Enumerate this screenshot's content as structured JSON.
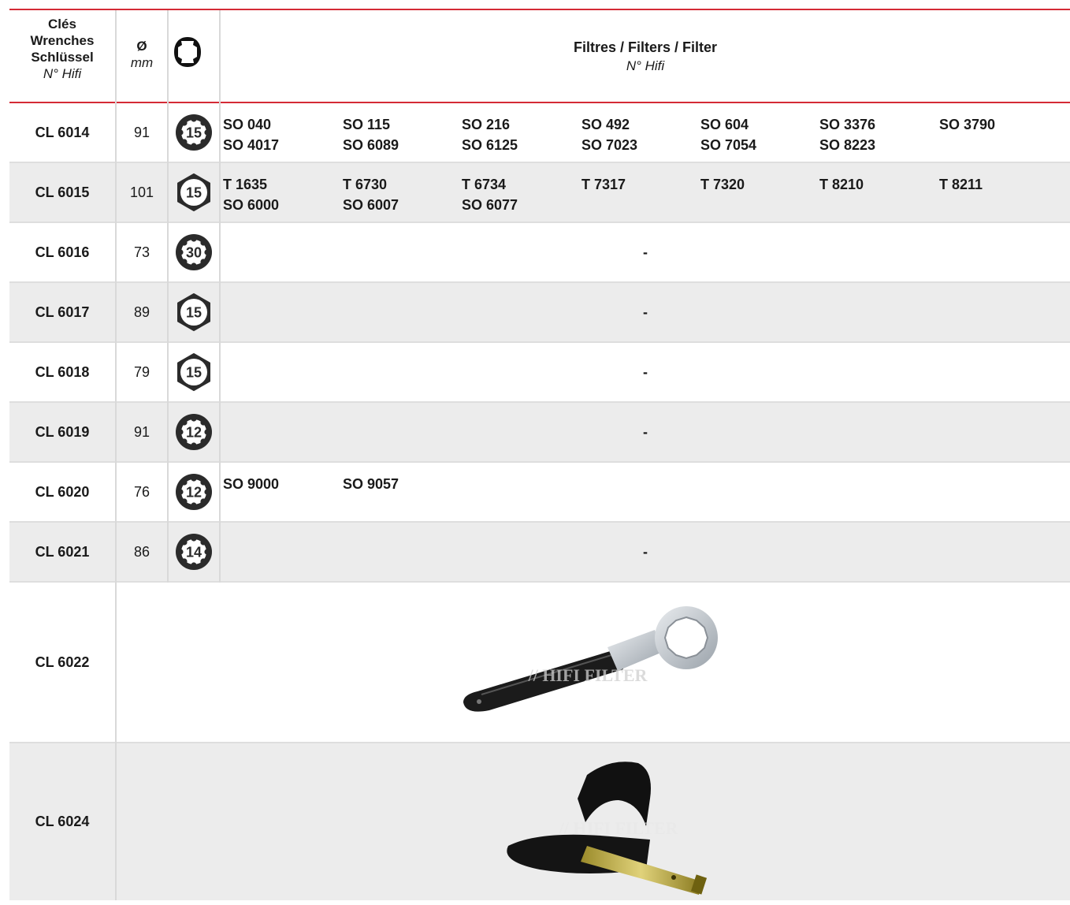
{
  "header": {
    "key_lines": [
      "Clés",
      "Wrenches",
      "Schlüssel"
    ],
    "key_sub": "N° Hifi",
    "dia_title": "Ø",
    "dia_unit": "mm",
    "filters_title": "Filtres / Filters / Filter",
    "filters_sub": "N° Hifi",
    "header_icon": "wrench-profile-icon"
  },
  "colors": {
    "accent": "#d42a35",
    "row_alt": "#ececec",
    "badge": "#2b2b2b"
  },
  "rows": [
    {
      "key": "CL 6014",
      "dia": "91",
      "icon": "splined-badge-icon",
      "badge": "15",
      "filters": [
        [
          "SO 040",
          "SO 4017"
        ],
        [
          "SO 115",
          "SO 6089"
        ],
        [
          "SO 216",
          "SO 6125"
        ],
        [
          "SO 492",
          "SO 7023"
        ],
        [
          "SO 604",
          "SO 7054"
        ],
        [
          "SO 3376",
          "SO 8223"
        ],
        [
          "SO 3790",
          ""
        ]
      ]
    },
    {
      "key": "CL 6015",
      "dia": "101",
      "icon": "hex-badge-icon",
      "badge": "15",
      "filters": [
        [
          "T 1635",
          "SO 6000"
        ],
        [
          "T 6730",
          "SO 6007"
        ],
        [
          "T 6734",
          "SO 6077"
        ],
        [
          "T 7317",
          ""
        ],
        [
          "T 7320",
          ""
        ],
        [
          "T 8210",
          ""
        ],
        [
          "T 8211",
          ""
        ]
      ]
    },
    {
      "key": "CL 6016",
      "dia": "73",
      "icon": "splined-badge-icon",
      "badge": "30",
      "dash": "-"
    },
    {
      "key": "CL 6017",
      "dia": "89",
      "icon": "hex-badge-icon",
      "badge": "15",
      "dash": "-"
    },
    {
      "key": "CL 6018",
      "dia": "79",
      "icon": "hex-badge-icon",
      "badge": "15",
      "dash": "-"
    },
    {
      "key": "CL 6019",
      "dia": "91",
      "icon": "splined-badge-icon",
      "badge": "12",
      "dash": "-"
    },
    {
      "key": "CL 6020",
      "dia": "76",
      "icon": "splined-badge-icon",
      "badge": "12",
      "filters": [
        [
          "SO 9000",
          ""
        ],
        [
          "SO 9057",
          ""
        ]
      ]
    },
    {
      "key": "CL 6021",
      "dia": "86",
      "icon": "splined-badge-icon",
      "badge": "14",
      "dash": "-"
    },
    {
      "key": "CL 6022",
      "photo": "ring-wrench-photo",
      "watermark": "HIFI FILTER"
    },
    {
      "key": "CL 6024",
      "photo": "strap-wrench-photo",
      "watermark": "HIFI FILTER"
    }
  ]
}
